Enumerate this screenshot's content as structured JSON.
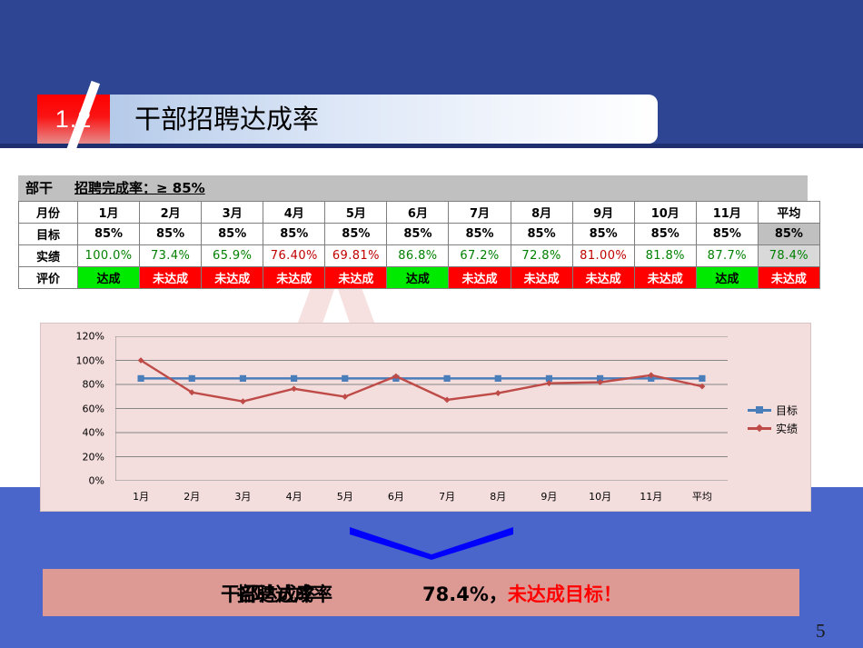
{
  "slide": {
    "number_badge": "1.2",
    "title": "干部招聘达成率",
    "page_number": "5",
    "watermark_text": "A"
  },
  "colors": {
    "background_top": "#2e4593",
    "background_bottom": "#4a66ca",
    "badge_red": "#ff0000",
    "eval_pass_bg": "#00ea00",
    "eval_fail_bg": "#ff0000",
    "chart_bg": "#f4dedd",
    "banner_bg": "#dd9a95",
    "target_series": "#4a7ebb",
    "actual_series": "#be4b48",
    "warn_text": "#ff0000"
  },
  "table": {
    "caption_dept": "部干",
    "caption_rate": "招聘完成率：≥ 85%",
    "row_labels": [
      "月份",
      "目标",
      "实绩",
      "评价"
    ],
    "columns": [
      "1月",
      "2月",
      "3月",
      "4月",
      "5月",
      "6月",
      "7月",
      "8月",
      "9月",
      "10月",
      "11月",
      "平均"
    ],
    "target": [
      "85%",
      "85%",
      "85%",
      "85%",
      "85%",
      "85%",
      "85%",
      "85%",
      "85%",
      "85%",
      "85%",
      "85%"
    ],
    "actual": [
      "100.0%",
      "73.4%",
      "65.9%",
      "76.40%",
      "69.81%",
      "86.8%",
      "67.2%",
      "72.8%",
      "81.00%",
      "81.8%",
      "87.7%",
      "78.4%"
    ],
    "actual_color": [
      "#008000",
      "#008000",
      "#008000",
      "#c00000",
      "#c00000",
      "#008000",
      "#008000",
      "#008000",
      "#c00000",
      "#008000",
      "#008000",
      "#008000"
    ],
    "evaluation": [
      "达成",
      "未达成",
      "未达成",
      "未达成",
      "未达成",
      "达成",
      "未达成",
      "未达成",
      "未达成",
      "未达成",
      "达成",
      "未达成"
    ],
    "evaluation_pass": [
      true,
      false,
      false,
      false,
      false,
      true,
      false,
      false,
      false,
      false,
      true,
      false
    ]
  },
  "chart_data": {
    "type": "line",
    "title": "",
    "xlabel": "",
    "ylabel": "",
    "categories": [
      "1月",
      "2月",
      "3月",
      "4月",
      "5月",
      "6月",
      "7月",
      "8月",
      "9月",
      "10月",
      "11月",
      "平均"
    ],
    "ylim": [
      0,
      120
    ],
    "ytick_labels": [
      "0%",
      "20%",
      "40%",
      "60%",
      "80%",
      "100%",
      "120%"
    ],
    "ytick_values": [
      0,
      20,
      40,
      60,
      80,
      100,
      120
    ],
    "grid": true,
    "legend_position": "right",
    "series": [
      {
        "name": "目标",
        "color": "#4a7ebb",
        "marker": "square",
        "values": [
          85,
          85,
          85,
          85,
          85,
          85,
          85,
          85,
          85,
          85,
          85,
          85
        ]
      },
      {
        "name": "实绩",
        "color": "#be4b48",
        "marker": "diamond",
        "values": [
          100.0,
          73.4,
          65.9,
          76.4,
          69.81,
          86.8,
          67.2,
          72.8,
          81.0,
          81.8,
          87.7,
          78.4
        ]
      }
    ]
  },
  "conclusion": {
    "overlay_text_back": "干部达成率",
    "overlay_text_front": "招聘达成率",
    "value": "78.4%，",
    "warning": "未达成目标！"
  }
}
